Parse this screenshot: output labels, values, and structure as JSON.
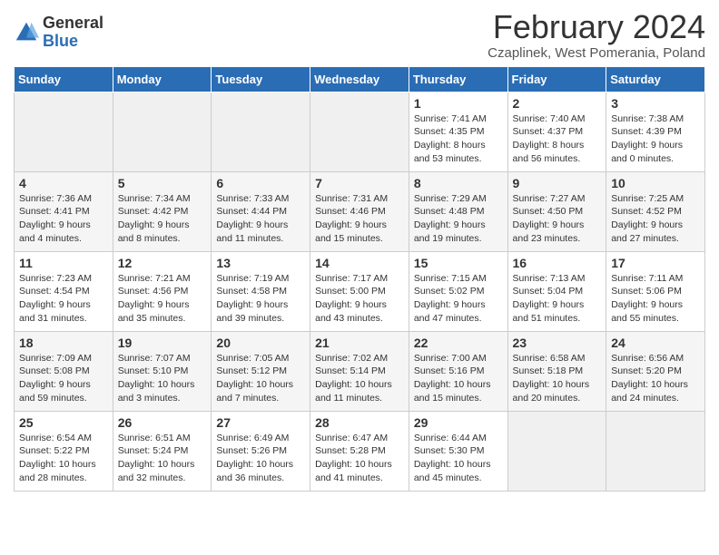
{
  "logo": {
    "general": "General",
    "blue": "Blue"
  },
  "title": "February 2024",
  "location": "Czaplinek, West Pomerania, Poland",
  "days_of_week": [
    "Sunday",
    "Monday",
    "Tuesday",
    "Wednesday",
    "Thursday",
    "Friday",
    "Saturday"
  ],
  "weeks": [
    [
      {
        "num": "",
        "info": ""
      },
      {
        "num": "",
        "info": ""
      },
      {
        "num": "",
        "info": ""
      },
      {
        "num": "",
        "info": ""
      },
      {
        "num": "1",
        "info": "Sunrise: 7:41 AM\nSunset: 4:35 PM\nDaylight: 8 hours and 53 minutes."
      },
      {
        "num": "2",
        "info": "Sunrise: 7:40 AM\nSunset: 4:37 PM\nDaylight: 8 hours and 56 minutes."
      },
      {
        "num": "3",
        "info": "Sunrise: 7:38 AM\nSunset: 4:39 PM\nDaylight: 9 hours and 0 minutes."
      }
    ],
    [
      {
        "num": "4",
        "info": "Sunrise: 7:36 AM\nSunset: 4:41 PM\nDaylight: 9 hours and 4 minutes."
      },
      {
        "num": "5",
        "info": "Sunrise: 7:34 AM\nSunset: 4:42 PM\nDaylight: 9 hours and 8 minutes."
      },
      {
        "num": "6",
        "info": "Sunrise: 7:33 AM\nSunset: 4:44 PM\nDaylight: 9 hours and 11 minutes."
      },
      {
        "num": "7",
        "info": "Sunrise: 7:31 AM\nSunset: 4:46 PM\nDaylight: 9 hours and 15 minutes."
      },
      {
        "num": "8",
        "info": "Sunrise: 7:29 AM\nSunset: 4:48 PM\nDaylight: 9 hours and 19 minutes."
      },
      {
        "num": "9",
        "info": "Sunrise: 7:27 AM\nSunset: 4:50 PM\nDaylight: 9 hours and 23 minutes."
      },
      {
        "num": "10",
        "info": "Sunrise: 7:25 AM\nSunset: 4:52 PM\nDaylight: 9 hours and 27 minutes."
      }
    ],
    [
      {
        "num": "11",
        "info": "Sunrise: 7:23 AM\nSunset: 4:54 PM\nDaylight: 9 hours and 31 minutes."
      },
      {
        "num": "12",
        "info": "Sunrise: 7:21 AM\nSunset: 4:56 PM\nDaylight: 9 hours and 35 minutes."
      },
      {
        "num": "13",
        "info": "Sunrise: 7:19 AM\nSunset: 4:58 PM\nDaylight: 9 hours and 39 minutes."
      },
      {
        "num": "14",
        "info": "Sunrise: 7:17 AM\nSunset: 5:00 PM\nDaylight: 9 hours and 43 minutes."
      },
      {
        "num": "15",
        "info": "Sunrise: 7:15 AM\nSunset: 5:02 PM\nDaylight: 9 hours and 47 minutes."
      },
      {
        "num": "16",
        "info": "Sunrise: 7:13 AM\nSunset: 5:04 PM\nDaylight: 9 hours and 51 minutes."
      },
      {
        "num": "17",
        "info": "Sunrise: 7:11 AM\nSunset: 5:06 PM\nDaylight: 9 hours and 55 minutes."
      }
    ],
    [
      {
        "num": "18",
        "info": "Sunrise: 7:09 AM\nSunset: 5:08 PM\nDaylight: 9 hours and 59 minutes."
      },
      {
        "num": "19",
        "info": "Sunrise: 7:07 AM\nSunset: 5:10 PM\nDaylight: 10 hours and 3 minutes."
      },
      {
        "num": "20",
        "info": "Sunrise: 7:05 AM\nSunset: 5:12 PM\nDaylight: 10 hours and 7 minutes."
      },
      {
        "num": "21",
        "info": "Sunrise: 7:02 AM\nSunset: 5:14 PM\nDaylight: 10 hours and 11 minutes."
      },
      {
        "num": "22",
        "info": "Sunrise: 7:00 AM\nSunset: 5:16 PM\nDaylight: 10 hours and 15 minutes."
      },
      {
        "num": "23",
        "info": "Sunrise: 6:58 AM\nSunset: 5:18 PM\nDaylight: 10 hours and 20 minutes."
      },
      {
        "num": "24",
        "info": "Sunrise: 6:56 AM\nSunset: 5:20 PM\nDaylight: 10 hours and 24 minutes."
      }
    ],
    [
      {
        "num": "25",
        "info": "Sunrise: 6:54 AM\nSunset: 5:22 PM\nDaylight: 10 hours and 28 minutes."
      },
      {
        "num": "26",
        "info": "Sunrise: 6:51 AM\nSunset: 5:24 PM\nDaylight: 10 hours and 32 minutes."
      },
      {
        "num": "27",
        "info": "Sunrise: 6:49 AM\nSunset: 5:26 PM\nDaylight: 10 hours and 36 minutes."
      },
      {
        "num": "28",
        "info": "Sunrise: 6:47 AM\nSunset: 5:28 PM\nDaylight: 10 hours and 41 minutes."
      },
      {
        "num": "29",
        "info": "Sunrise: 6:44 AM\nSunset: 5:30 PM\nDaylight: 10 hours and 45 minutes."
      },
      {
        "num": "",
        "info": ""
      },
      {
        "num": "",
        "info": ""
      }
    ]
  ]
}
